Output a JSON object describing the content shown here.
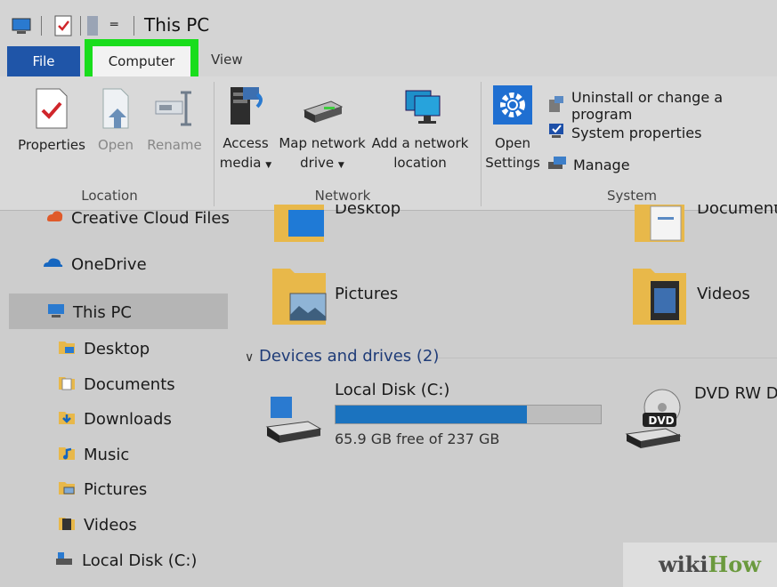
{
  "window": {
    "title": "This PC"
  },
  "tabs": {
    "file": "File",
    "computer": "Computer",
    "view": "View"
  },
  "ribbon": {
    "location": {
      "label": "Location",
      "properties": "Properties",
      "open": "Open",
      "rename": "Rename"
    },
    "network": {
      "label": "Network",
      "access_media_1": "Access",
      "access_media_2": "media",
      "map_drive_1": "Map network",
      "map_drive_2": "drive",
      "add_location_1": "Add a network",
      "add_location_2": "location"
    },
    "system": {
      "label": "System",
      "open_settings_1": "Open",
      "open_settings_2": "Settings",
      "uninstall": "Uninstall or change a program",
      "system_properties": "System properties",
      "manage": "Manage"
    }
  },
  "sidebar": {
    "items": [
      {
        "label": "Creative Cloud Files",
        "icon": "creative-cloud-icon"
      },
      {
        "label": "OneDrive",
        "icon": "onedrive-icon"
      },
      {
        "label": "This PC",
        "icon": "this-pc-icon",
        "selected": true
      },
      {
        "label": "Desktop",
        "icon": "desktop-folder-icon"
      },
      {
        "label": "Documents",
        "icon": "documents-folder-icon"
      },
      {
        "label": "Downloads",
        "icon": "downloads-folder-icon"
      },
      {
        "label": "Music",
        "icon": "music-folder-icon"
      },
      {
        "label": "Pictures",
        "icon": "pictures-folder-icon"
      },
      {
        "label": "Videos",
        "icon": "videos-folder-icon"
      },
      {
        "label": "Local Disk (C:)",
        "icon": "local-disk-icon"
      }
    ]
  },
  "folders": {
    "desktop": "Desktop",
    "documents": "Documents",
    "pictures": "Pictures",
    "videos": "Videos"
  },
  "devices": {
    "header": "Devices and drives (2)",
    "local_disk": {
      "name": "Local Disk (C:)",
      "free_text": "65.9 GB free of 237 GB",
      "used_fraction": 0.72
    },
    "dvd": {
      "name": "DVD RW D",
      "badge": "DVD"
    }
  },
  "watermark": {
    "part1": "wiki",
    "part2": "How"
  },
  "colors": {
    "accent": "#1f55a8",
    "highlight": "#19dd1c",
    "disk_fill": "#1b73bf"
  }
}
